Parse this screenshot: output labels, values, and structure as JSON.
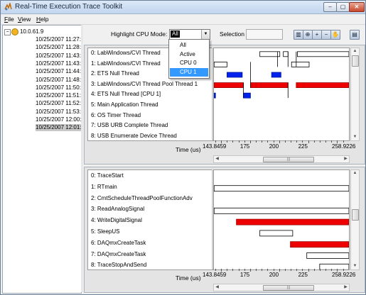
{
  "window": {
    "title": "Real-Time Execution Trace Toolkit"
  },
  "menu": [
    {
      "label": "File",
      "key": "F",
      "rest": "ile"
    },
    {
      "label": "View",
      "key": "V",
      "rest": "iew"
    },
    {
      "label": "Help",
      "key": "H",
      "rest": "elp"
    }
  ],
  "tree": {
    "root": "10.0.61.9",
    "items": [
      "10/25/2007 11:27:",
      "10/25/2007 11:28:",
      "10/25/2007 11:43:",
      "10/25/2007 11:43:",
      "10/25/2007 11:44:",
      "10/25/2007 11:48:",
      "10/25/2007 11:50:",
      "10/25/2007 11:51:",
      "10/25/2007 11:52:",
      "10/25/2007 11:53:",
      "10/25/2007 12:00:",
      "10/25/2007 12:01:"
    ],
    "selected_index": 11
  },
  "toolbar": {
    "highlight_label": "Highlight CPU Mode:",
    "cpu_mode": "All",
    "selection_label": "Selection",
    "tools": [
      "bar-chart-icon",
      "zoom-box-icon",
      "zoom-in-icon",
      "zoom-out-icon",
      "pan-hand-icon",
      "export-icon"
    ]
  },
  "cpu_dropdown": {
    "options": [
      "All",
      "Active",
      "CPU 0",
      "CPU 1"
    ],
    "highlighted_index": 3
  },
  "threads_pane": {
    "rows": [
      "0: LabWindows/CVI Thread",
      "1: LabWindows/CVI Thread",
      "2: ETS Null Thread",
      "3: LabWindows/CVI Thread Pool Thread 1",
      "4: ETS Null Thread [CPU 1]",
      "5: Main Application Thread",
      "6: OS Timer Thread",
      "7: USB URB Complete Thread",
      "8: USB Enumerate Device Thread"
    ],
    "axis_title": "Time (us)",
    "ticks": [
      "143.8459",
      "175",
      "200",
      "225",
      "258.9226"
    ]
  },
  "events_pane": {
    "rows": [
      "0: TraceStart",
      "1: RTmain",
      "2: CmtScheduleThreadPoolFunctionAdv",
      "3: ReadAnalogSignal",
      "4: WriteDigitalSignal",
      "5: SleepUS",
      "6: DAQmxCreateTask",
      "7: DAQmxCreateTask",
      "8: TraceStopAndSend"
    ],
    "axis_title": "Time (us)",
    "ticks": [
      "143.8459",
      "175",
      "200",
      "225",
      "258.9226"
    ]
  },
  "chart_data": [
    {
      "type": "gantt",
      "title": "",
      "xlabel": "Time (us)",
      "xlim": [
        143.8459,
        258.9226
      ],
      "ticks": [
        143.8459,
        175,
        200,
        225,
        258.9226
      ],
      "highlight_colors": {
        "CPU 0": "#ee0000",
        "CPU 1": "#0022ee"
      },
      "segments": [
        {
          "row": 0,
          "start": 183,
          "end": 200,
          "cpu": "none"
        },
        {
          "row": 0,
          "start": 203,
          "end": 207,
          "cpu": "none"
        },
        {
          "row": 0,
          "start": 215,
          "end": 258.9,
          "cpu": "none"
        },
        {
          "row": 1,
          "start": 144,
          "end": 155,
          "cpu": "none"
        },
        {
          "row": 1,
          "start": 210,
          "end": 225,
          "cpu": "none"
        },
        {
          "row": 2,
          "start": 155,
          "end": 168,
          "cpu": "CPU 1"
        },
        {
          "row": 2,
          "start": 193,
          "end": 201,
          "cpu": "CPU 1"
        },
        {
          "row": 3,
          "start": 144,
          "end": 169,
          "cpu": "CPU 0"
        },
        {
          "row": 3,
          "start": 175,
          "end": 207,
          "cpu": "CPU 0"
        },
        {
          "row": 3,
          "start": 214,
          "end": 258.9,
          "cpu": "CPU 0"
        },
        {
          "row": 4,
          "start": 144,
          "end": 145,
          "cpu": "CPU 1"
        },
        {
          "row": 4,
          "start": 169,
          "end": 175,
          "cpu": "CPU 1"
        }
      ],
      "markers": [
        {
          "row_from": 0,
          "row_to": 1,
          "x": 198
        },
        {
          "row_from": 0,
          "row_to": 1,
          "x": 207
        },
        {
          "row_from": 0,
          "row_to": 1,
          "x": 214
        },
        {
          "row_from": 1,
          "row_to": 3,
          "x": 175
        },
        {
          "row_from": 3,
          "row_to": 4,
          "x": 169
        },
        {
          "row_from": 3,
          "row_to": 4,
          "x": 207
        }
      ]
    },
    {
      "type": "gantt",
      "title": "",
      "xlabel": "Time (us)",
      "xlim": [
        143.8459,
        258.9226
      ],
      "ticks": [
        143.8459,
        175,
        200,
        225,
        258.9226
      ],
      "segments": [
        {
          "row": 1,
          "start": 144,
          "end": 258.9,
          "cpu": "none"
        },
        {
          "row": 3,
          "start": 144,
          "end": 258.9,
          "cpu": "none"
        },
        {
          "row": 4,
          "start": 163,
          "end": 258.9,
          "cpu": "CPU 0"
        },
        {
          "row": 5,
          "start": 183,
          "end": 211,
          "cpu": "none"
        },
        {
          "row": 6,
          "start": 209,
          "end": 258.9,
          "cpu": "CPU 0"
        },
        {
          "row": 7,
          "start": 223,
          "end": 258.9,
          "cpu": "none"
        },
        {
          "row": 8,
          "start": 234,
          "end": 258.9,
          "cpu": "none"
        }
      ],
      "markers": []
    }
  ]
}
